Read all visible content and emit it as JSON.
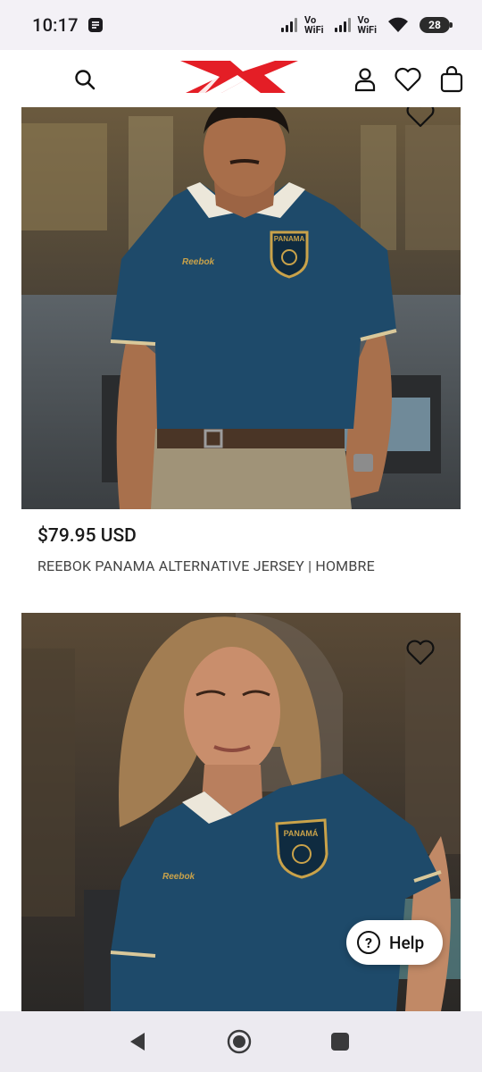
{
  "status_bar": {
    "time": "10:17",
    "vowifi_1": "Vo\nWiFi",
    "vowifi_2": "Vo\nWiFi",
    "battery": "28"
  },
  "header": {
    "brand": "Reebok",
    "brand_color": "#e41e26",
    "icons": [
      "search-icon",
      "account-icon",
      "heart-icon",
      "bag-icon"
    ]
  },
  "products": [
    {
      "price": "$79.95 USD",
      "name": "REEBOK PANAMA ALTERNATIVE JERSEY | HOMBRE",
      "image": "man wearing navy Panama jersey",
      "jersey_crest_text": "PANAMA",
      "jersey_brand_text": "Reebok"
    },
    {
      "price": "",
      "name": "",
      "image": "woman wearing navy Panama jersey",
      "jersey_crest_text": "PANAMÁ",
      "jersey_brand_text": "Reebok"
    }
  ],
  "help_button": {
    "label": "Help"
  },
  "nav_bar": {
    "icons": [
      "back-icon",
      "home-icon",
      "recents-icon"
    ]
  },
  "colors": {
    "jersey_navy": "#1e4a6a",
    "gold": "#c9a24a"
  }
}
